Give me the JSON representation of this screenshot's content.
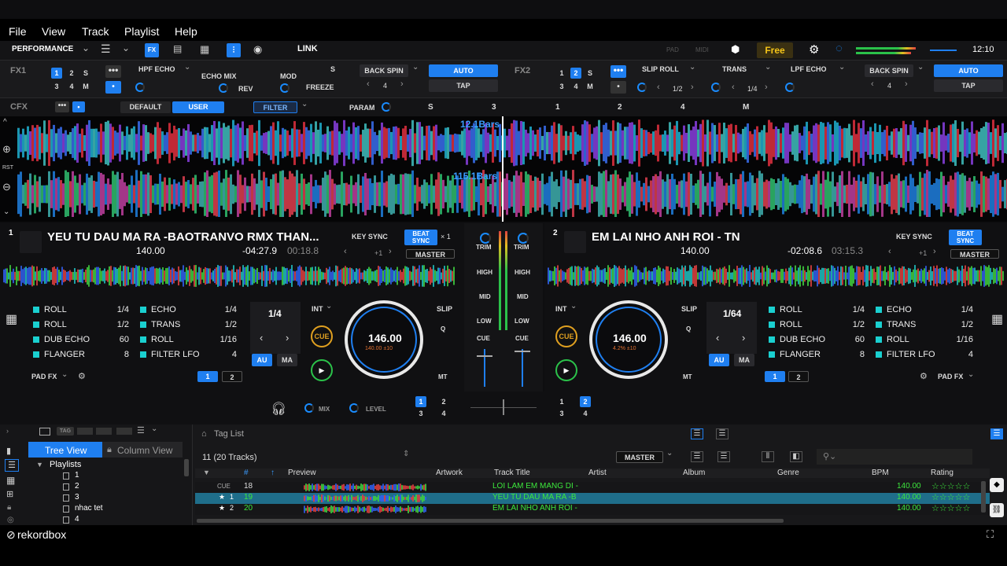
{
  "menu": {
    "file": "File",
    "view": "View",
    "track": "Track",
    "playlist": "Playlist",
    "help": "Help"
  },
  "toolbar": {
    "mode": "PERFORMANCE",
    "link": "LINK",
    "pad": "PAD",
    "midi": "MIDI",
    "free": "Free",
    "clock": "12:10"
  },
  "fx1": {
    "label": "FX1",
    "effect1": "HPF ECHO",
    "effect2": "ECHO MIX",
    "effect2b": "REV",
    "effect3": "MOD",
    "effect3b": "FREEZE",
    "s": "S",
    "backspin": "BACK SPIN",
    "beat": "4",
    "auto": "AUTO",
    "tap": "TAP",
    "n1": "1",
    "n2": "2",
    "n3": "3",
    "n4": "4",
    "m": "M"
  },
  "fx2": {
    "label": "FX2",
    "effect1": "SLIP ROLL",
    "effect1v": "1/2",
    "effect2": "TRANS",
    "effect2v": "1/4",
    "effect3": "LPF ECHO",
    "backspin": "BACK SPIN",
    "beat": "4",
    "auto": "AUTO",
    "tap": "TAP",
    "s": "S",
    "m": "M"
  },
  "cfx": {
    "label": "CFX",
    "default": "DEFAULT",
    "user": "USER",
    "filter": "FILTER",
    "param": "PARAM",
    "s": "S",
    "v3": "3",
    "v1": "1",
    "v2": "2",
    "v4": "4",
    "m": "M"
  },
  "waveform": {
    "bars1": "12.1Bars",
    "bars2": "115.1Bars",
    "rst": "RST"
  },
  "deck1": {
    "num": "1",
    "title": "YEU TU DAU MA RA -BAOTRANVO RMX THAN...",
    "bpm_small": "140.00",
    "remain": "-04:27.9",
    "elapsed": "00:18.8",
    "keysync": "KEY SYNC",
    "beatsync": "BEAT SYNC",
    "x1": "× 1",
    "plus1": "+1",
    "master": "MASTER",
    "loop": "1/4",
    "int": "INT",
    "slip": "SLIP",
    "q": "Q",
    "cue": "CUE",
    "au": "AU",
    "ma": "MA",
    "mt": "MT",
    "jog_bpm": "146.00",
    "jog_sub": "140.00  ±10",
    "padfx": "PAD FX",
    "pg1": "1",
    "pg2": "2",
    "pads": [
      {
        "name": "ROLL",
        "val": "1/4"
      },
      {
        "name": "ECHO",
        "val": "1/4"
      },
      {
        "name": "ROLL",
        "val": "1/2"
      },
      {
        "name": "TRANS",
        "val": "1/2"
      },
      {
        "name": "DUB ECHO",
        "val": "60"
      },
      {
        "name": "ROLL",
        "val": "1/16"
      },
      {
        "name": "FLANGER",
        "val": "8"
      },
      {
        "name": "FILTER LFO",
        "val": "4"
      }
    ]
  },
  "deck2": {
    "num": "2",
    "title": "EM LAI NHO ANH ROI - TN",
    "bpm_small": "140.00",
    "remain": "-02:08.6",
    "elapsed": "03:15.3",
    "keysync": "KEY SYNC",
    "beatsync": "BEAT SYNC",
    "plus1": "+1",
    "master": "MASTER",
    "loop": "1/64",
    "int": "INT",
    "slip": "SLIP",
    "q": "Q",
    "cue": "CUE",
    "au": "AU",
    "ma": "MA",
    "mt": "MT",
    "jog_bpm": "146.00",
    "jog_sub": "4.2%  ±10",
    "padfx": "PAD FX",
    "pg1": "1",
    "pg2": "2",
    "pads": [
      {
        "name": "ROLL",
        "val": "1/4"
      },
      {
        "name": "ECHO",
        "val": "1/4"
      },
      {
        "name": "ROLL",
        "val": "1/2"
      },
      {
        "name": "TRANS",
        "val": "1/2"
      },
      {
        "name": "DUB ECHO",
        "val": "60"
      },
      {
        "name": "ROLL",
        "val": "1/16"
      },
      {
        "name": "FLANGER",
        "val": "8"
      },
      {
        "name": "FILTER LFO",
        "val": "4"
      }
    ]
  },
  "mixer": {
    "trim": "TRIM",
    "high": "HIGH",
    "mid": "MID",
    "low": "LOW",
    "cue": "CUE",
    "mix": "MIX",
    "level": "LEVEL",
    "n1": "1",
    "n2": "2",
    "n3": "3",
    "n4": "4"
  },
  "browser": {
    "tag": "TAG",
    "treeview": "Tree View",
    "columnview": "Column View",
    "taglist": "Tag List",
    "count": "11 (20 Tracks)",
    "master": "MASTER",
    "tree": [
      "Playlists",
      "1",
      "2",
      "3",
      "nhac tet",
      "4"
    ],
    "cols": {
      "num": "#",
      "preview": "Preview",
      "artwork": "Artwork",
      "title": "Track Title",
      "artist": "Artist",
      "album": "Album",
      "genre": "Genre",
      "bpm": "BPM",
      "rating": "Rating"
    },
    "rows": [
      {
        "deck": "CUE",
        "num": "18",
        "title": "LOI LAM EM MANG DI -",
        "bpm": "140.00"
      },
      {
        "deck": "1",
        "num": "19",
        "title": "YEU TU DAU MA RA -B",
        "bpm": "140.00"
      },
      {
        "deck": "2",
        "num": "20",
        "title": "EM LAI NHO ANH ROI -",
        "bpm": "140.00"
      }
    ]
  },
  "footer": {
    "logo": "rekordbox"
  }
}
